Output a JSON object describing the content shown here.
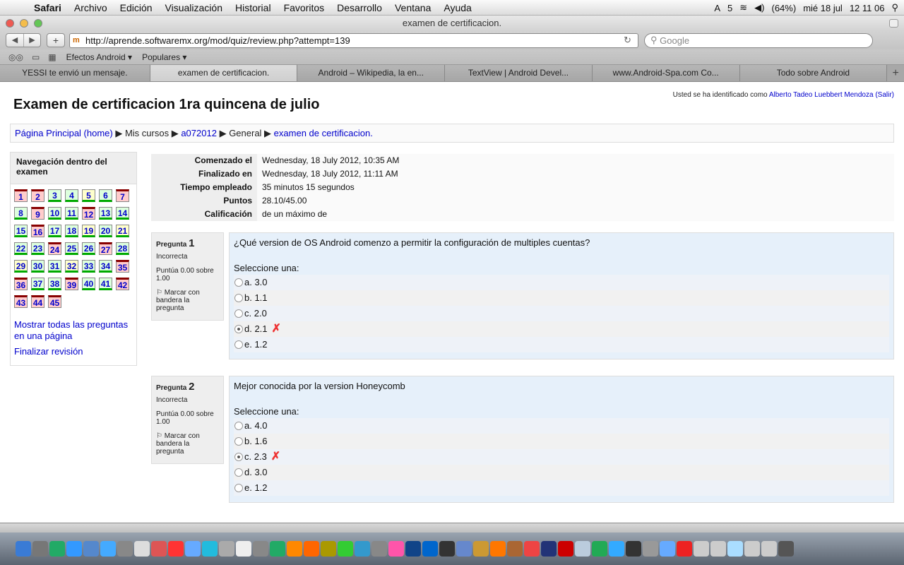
{
  "menubar": {
    "app": "Safari",
    "items": [
      "Archivo",
      "Edición",
      "Visualización",
      "Historial",
      "Favoritos",
      "Desarrollo",
      "Ventana",
      "Ayuda"
    ],
    "status": [
      "5",
      "(64%)",
      "mié 18 jul",
      "12 11 06"
    ]
  },
  "window": {
    "title": "examen de certificacion."
  },
  "toolbar": {
    "url": "http://aprende.softwaremx.org/mod/quiz/review.php?attempt=139",
    "search_placeholder": "Google"
  },
  "bookmarks": [
    "Efectos Android ▾",
    "Populares ▾"
  ],
  "tabs": [
    "YESSI te envió un mensaje.",
    "examen de certificacion.",
    "Android – Wikipedia, la en...",
    "TextView | Android Devel...",
    "www.Android-Spa.com Co...",
    "Todo sobre Android"
  ],
  "page": {
    "login_prefix": "Usted se ha identificado como",
    "login_user": "Alberto Tadeo Luebbert Mendoza",
    "login_exit": "(Salir)",
    "title": "Examen de certificacion 1ra quincena de julio",
    "breadcrumb": [
      "Página Principal (home)",
      "Mis cursos",
      "a072012",
      "General",
      "examen de certificacion."
    ],
    "nav_title": "Navegación dentro del examen",
    "nav_buttons": [
      {
        "n": "1",
        "s": "w"
      },
      {
        "n": "2",
        "s": "w"
      },
      {
        "n": "3",
        "s": "c"
      },
      {
        "n": "4",
        "s": "c"
      },
      {
        "n": "5",
        "s": "p"
      },
      {
        "n": "6",
        "s": "c"
      },
      {
        "n": "7",
        "s": "w"
      },
      {
        "n": "8",
        "s": "c"
      },
      {
        "n": "9",
        "s": "w"
      },
      {
        "n": "10",
        "s": "c"
      },
      {
        "n": "11",
        "s": "c"
      },
      {
        "n": "12",
        "s": "w"
      },
      {
        "n": "13",
        "s": "c"
      },
      {
        "n": "14",
        "s": "c"
      },
      {
        "n": "15",
        "s": "c"
      },
      {
        "n": "16",
        "s": "w"
      },
      {
        "n": "17",
        "s": "c"
      },
      {
        "n": "18",
        "s": "c"
      },
      {
        "n": "19",
        "s": "p"
      },
      {
        "n": "20",
        "s": "c"
      },
      {
        "n": "21",
        "s": "p"
      },
      {
        "n": "22",
        "s": "c"
      },
      {
        "n": "23",
        "s": "c"
      },
      {
        "n": "24",
        "s": "w"
      },
      {
        "n": "25",
        "s": "c"
      },
      {
        "n": "26",
        "s": "c"
      },
      {
        "n": "27",
        "s": "w"
      },
      {
        "n": "28",
        "s": "c"
      },
      {
        "n": "29",
        "s": "p"
      },
      {
        "n": "30",
        "s": "c"
      },
      {
        "n": "31",
        "s": "c"
      },
      {
        "n": "32",
        "s": "p"
      },
      {
        "n": "33",
        "s": "c"
      },
      {
        "n": "34",
        "s": "c"
      },
      {
        "n": "35",
        "s": "w"
      },
      {
        "n": "36",
        "s": "w"
      },
      {
        "n": "37",
        "s": "c"
      },
      {
        "n": "38",
        "s": "c"
      },
      {
        "n": "39",
        "s": "w"
      },
      {
        "n": "40",
        "s": "c"
      },
      {
        "n": "41",
        "s": "c"
      },
      {
        "n": "42",
        "s": "w"
      },
      {
        "n": "43",
        "s": "w"
      },
      {
        "n": "44",
        "s": "w"
      },
      {
        "n": "45",
        "s": "w"
      }
    ],
    "nav_show_all": "Mostrar todas las preguntas en una página",
    "nav_finish": "Finalizar revisión",
    "summary": [
      {
        "k": "Comenzado el",
        "v": "Wednesday, 18 July 2012, 10:35 AM"
      },
      {
        "k": "Finalizado en",
        "v": "Wednesday, 18 July 2012, 11:11 AM"
      },
      {
        "k": "Tiempo empleado",
        "v": "35 minutos 15 segundos"
      },
      {
        "k": "Puntos",
        "v": "28.10/45.00"
      },
      {
        "k": "Calificación",
        "v": "de un máximo de"
      }
    ],
    "questions": [
      {
        "label": "Pregunta",
        "num": "1",
        "state": "Incorrecta",
        "grade": "Puntúa 0.00 sobre 1.00",
        "flag": "Marcar con bandera la pregunta",
        "text": "¿Qué version de OS Android comenzo a permitir la configuración de multiples cuentas?",
        "select": "Seleccione una:",
        "options": [
          "a. 3.0",
          "b. 1.1",
          "c. 2.0",
          "d. 2.1",
          "e. 1.2"
        ],
        "chosen": 3
      },
      {
        "label": "Pregunta",
        "num": "2",
        "state": "Incorrecta",
        "grade": "Puntúa 0.00 sobre 1.00",
        "flag": "Marcar con bandera la pregunta",
        "text": "Mejor conocida por la version Honeycomb",
        "select": "Seleccione una:",
        "options": [
          "a. 4.0",
          "b. 1.6",
          "c. 2.3",
          "d. 3.0",
          "e. 1.2"
        ],
        "chosen": 2
      }
    ]
  }
}
